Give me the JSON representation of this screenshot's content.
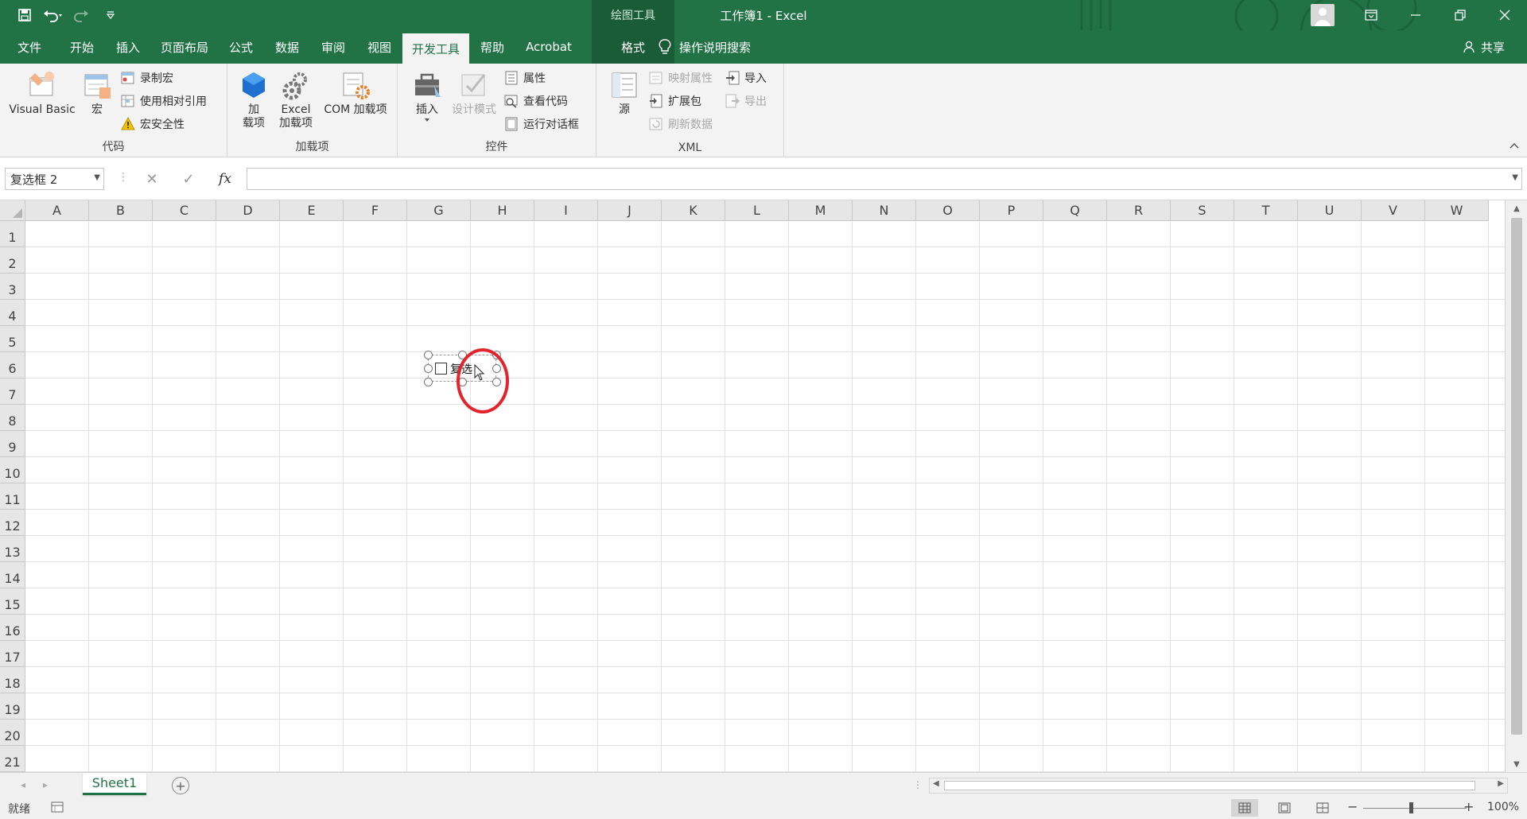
{
  "app": {
    "context_title": "绘图工具",
    "doc_title": "工作簿1  -  Excel",
    "colors": {
      "brand": "#217346",
      "accent_red": "#e4242d"
    }
  },
  "qat": {
    "icons": [
      "save-icon",
      "undo-icon",
      "redo-icon",
      "customize-qat-icon"
    ]
  },
  "tabs": [
    {
      "label": "文件"
    },
    {
      "label": "开始"
    },
    {
      "label": "插入"
    },
    {
      "label": "页面布局"
    },
    {
      "label": "公式"
    },
    {
      "label": "数据"
    },
    {
      "label": "审阅"
    },
    {
      "label": "视图"
    },
    {
      "label": "开发工具",
      "active": true
    },
    {
      "label": "帮助"
    },
    {
      "label": "Acrobat"
    },
    {
      "label": "格式",
      "contextual": true
    }
  ],
  "search": {
    "label": "操作说明搜索"
  },
  "share": {
    "label": "共享"
  },
  "ribbon": {
    "code": {
      "label": "代码",
      "visual_basic": "Visual Basic",
      "macros": "宏",
      "record_macro": "录制宏",
      "relative_refs": "使用相对引用",
      "macro_security": "宏安全性"
    },
    "addins": {
      "label": "加载项",
      "addins_line1": "加",
      "addins_line2": "载项",
      "excel_addins_line1": "Excel",
      "excel_addins_line2": "加载项",
      "com_addins": "COM 加载项"
    },
    "controls": {
      "label": "控件",
      "insert": "插入",
      "design_mode": "设计模式",
      "properties": "属性",
      "view_code": "查看代码",
      "run_dialog": "运行对话框"
    },
    "xml": {
      "label": "XML",
      "source": "源",
      "map_properties": "映射属性",
      "expansion_packs": "扩展包",
      "refresh_data": "刷新数据",
      "import": "导入",
      "export": "导出"
    }
  },
  "formula_bar": {
    "name_box": "复选框 2",
    "cancel": "✕",
    "enter": "✓",
    "fx": "fx",
    "value": ""
  },
  "grid": {
    "columns": [
      "A",
      "B",
      "C",
      "D",
      "E",
      "F",
      "G",
      "H",
      "I",
      "J",
      "K",
      "L",
      "M",
      "N",
      "O",
      "P",
      "Q",
      "R",
      "S",
      "T",
      "U",
      "V",
      "W"
    ],
    "rows": [
      "1",
      "2",
      "3",
      "4",
      "5",
      "6",
      "7",
      "8",
      "9",
      "10",
      "11",
      "12",
      "13",
      "14",
      "15",
      "16",
      "17",
      "18",
      "19",
      "20",
      "21"
    ],
    "checkbox_label": "复选"
  },
  "sheets": {
    "tabs": [
      "Sheet1"
    ],
    "add": "+"
  },
  "status": {
    "ready": "就绪",
    "zoom": "100%",
    "zoom_minus": "−",
    "zoom_plus": "+"
  }
}
